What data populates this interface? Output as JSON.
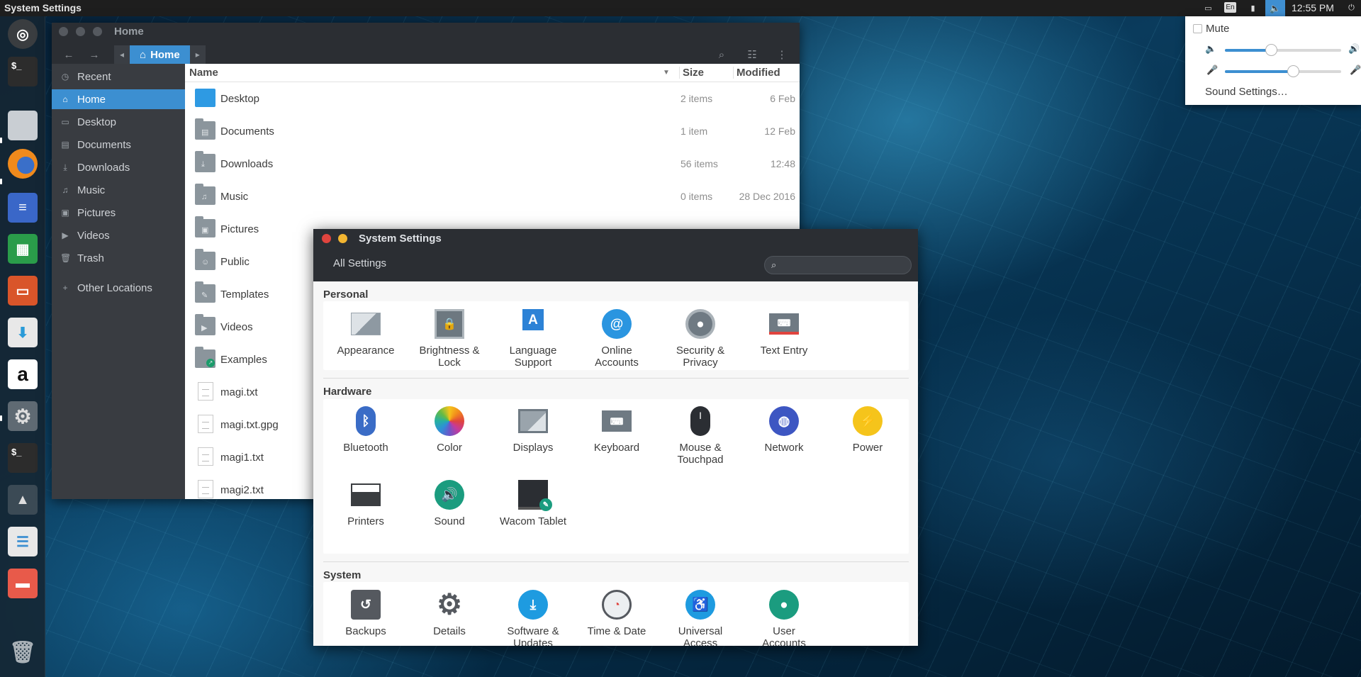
{
  "topbar": {
    "title": "System Settings",
    "clock": "12:55 PM",
    "lang": "En",
    "indicators": [
      "monitor-icon",
      "keyboard-lang-icon",
      "battery-icon",
      "volume-icon",
      "power-icon"
    ]
  },
  "launcher": {
    "items": [
      "ubuntu-dash-icon",
      "terminal-icon",
      "files-icon",
      "firefox-icon",
      "writer-icon",
      "calc-icon",
      "impress-icon",
      "software-center-icon",
      "amazon-icon",
      "system-settings-icon",
      "terminal-icon",
      "inkscape-icon",
      "tweak-tool-icon",
      "image-viewer-icon",
      "trash-icon"
    ]
  },
  "files": {
    "title": "Home",
    "path_label": "Home",
    "sidebar": [
      {
        "label": "Recent",
        "icon": "clock-icon"
      },
      {
        "label": "Home",
        "icon": "home-icon",
        "selected": true
      },
      {
        "label": "Desktop",
        "icon": "desktop-icon"
      },
      {
        "label": "Documents",
        "icon": "documents-icon"
      },
      {
        "label": "Downloads",
        "icon": "download-icon"
      },
      {
        "label": "Music",
        "icon": "music-icon"
      },
      {
        "label": "Pictures",
        "icon": "pictures-icon"
      },
      {
        "label": "Videos",
        "icon": "video-icon"
      },
      {
        "label": "Trash",
        "icon": "trash-icon"
      },
      {
        "label": "Other Locations",
        "icon": "plus-icon"
      }
    ],
    "columns": {
      "name": "Name",
      "size": "Size",
      "modified": "Modified"
    },
    "rows": [
      {
        "name": "Desktop",
        "size": "2 items",
        "modified": "6 Feb",
        "type": "desktop-folder"
      },
      {
        "name": "Documents",
        "size": "1 item",
        "modified": "12 Feb",
        "type": "folder"
      },
      {
        "name": "Downloads",
        "size": "56 items",
        "modified": "12:48",
        "type": "folder"
      },
      {
        "name": "Music",
        "size": "0 items",
        "modified": "28 Dec 2016",
        "type": "folder"
      },
      {
        "name": "Pictures",
        "size": "",
        "modified": "",
        "type": "folder"
      },
      {
        "name": "Public",
        "size": "",
        "modified": "",
        "type": "folder"
      },
      {
        "name": "Templates",
        "size": "",
        "modified": "",
        "type": "folder"
      },
      {
        "name": "Videos",
        "size": "",
        "modified": "",
        "type": "folder"
      },
      {
        "name": "Examples",
        "size": "",
        "modified": "",
        "type": "folder-link"
      },
      {
        "name": "magi.txt",
        "size": "",
        "modified": "",
        "type": "file"
      },
      {
        "name": "magi.txt.gpg",
        "size": "",
        "modified": "",
        "type": "file"
      },
      {
        "name": "magi1.txt",
        "size": "",
        "modified": "",
        "type": "file"
      },
      {
        "name": "magi2.txt",
        "size": "",
        "modified": "",
        "type": "file"
      }
    ]
  },
  "settings": {
    "title": "System Settings",
    "all_settings": "All Settings",
    "search_placeholder": "",
    "sections": [
      {
        "label": "Personal",
        "items": [
          {
            "line1": "Appearance",
            "line2": "",
            "icon": "appearance-icon"
          },
          {
            "line1": "Brightness &",
            "line2": "Lock",
            "icon": "brightness-lock-icon"
          },
          {
            "line1": "Language",
            "line2": "Support",
            "icon": "language-icon"
          },
          {
            "line1": "Online",
            "line2": "Accounts",
            "icon": "online-accounts-icon"
          },
          {
            "line1": "Security &",
            "line2": "Privacy",
            "icon": "security-icon"
          },
          {
            "line1": "Text Entry",
            "line2": "",
            "icon": "keyboard-entry-icon"
          }
        ]
      },
      {
        "label": "Hardware",
        "items": [
          {
            "line1": "Bluetooth",
            "line2": "",
            "icon": "bluetooth-icon"
          },
          {
            "line1": "Color",
            "line2": "",
            "icon": "color-icon"
          },
          {
            "line1": "Displays",
            "line2": "",
            "icon": "displays-icon"
          },
          {
            "line1": "Keyboard",
            "line2": "",
            "icon": "keyboard-icon"
          },
          {
            "line1": "Mouse &",
            "line2": "Touchpad",
            "icon": "mouse-icon"
          },
          {
            "line1": "Network",
            "line2": "",
            "icon": "network-icon"
          },
          {
            "line1": "Power",
            "line2": "",
            "icon": "power-icon"
          },
          {
            "line1": "Printers",
            "line2": "",
            "icon": "printer-icon"
          },
          {
            "line1": "Sound",
            "line2": "",
            "icon": "sound-icon"
          },
          {
            "line1": "Wacom Tablet",
            "line2": "",
            "icon": "wacom-icon"
          }
        ]
      },
      {
        "label": "System",
        "items": [
          {
            "line1": "Backups",
            "line2": "",
            "icon": "backups-icon"
          },
          {
            "line1": "Details",
            "line2": "",
            "icon": "details-icon"
          },
          {
            "line1": "Software &",
            "line2": "Updates",
            "icon": "software-updates-icon"
          },
          {
            "line1": "Time & Date",
            "line2": "",
            "icon": "clock-icon"
          },
          {
            "line1": "Universal",
            "line2": "Access",
            "icon": "accessibility-icon"
          },
          {
            "line1": "User",
            "line2": "Accounts",
            "icon": "user-icon"
          }
        ]
      }
    ]
  },
  "sound_menu": {
    "mute_label": "Mute",
    "mute_checked": false,
    "output_volume": 0.4,
    "input_volume": 0.59,
    "settings_label": "Sound Settings…"
  },
  "colors": {
    "accent": "#3c8fd1",
    "headerbar": "#2b2e33",
    "sidebar": "#393c41",
    "topbar": "#1e1e1e"
  }
}
